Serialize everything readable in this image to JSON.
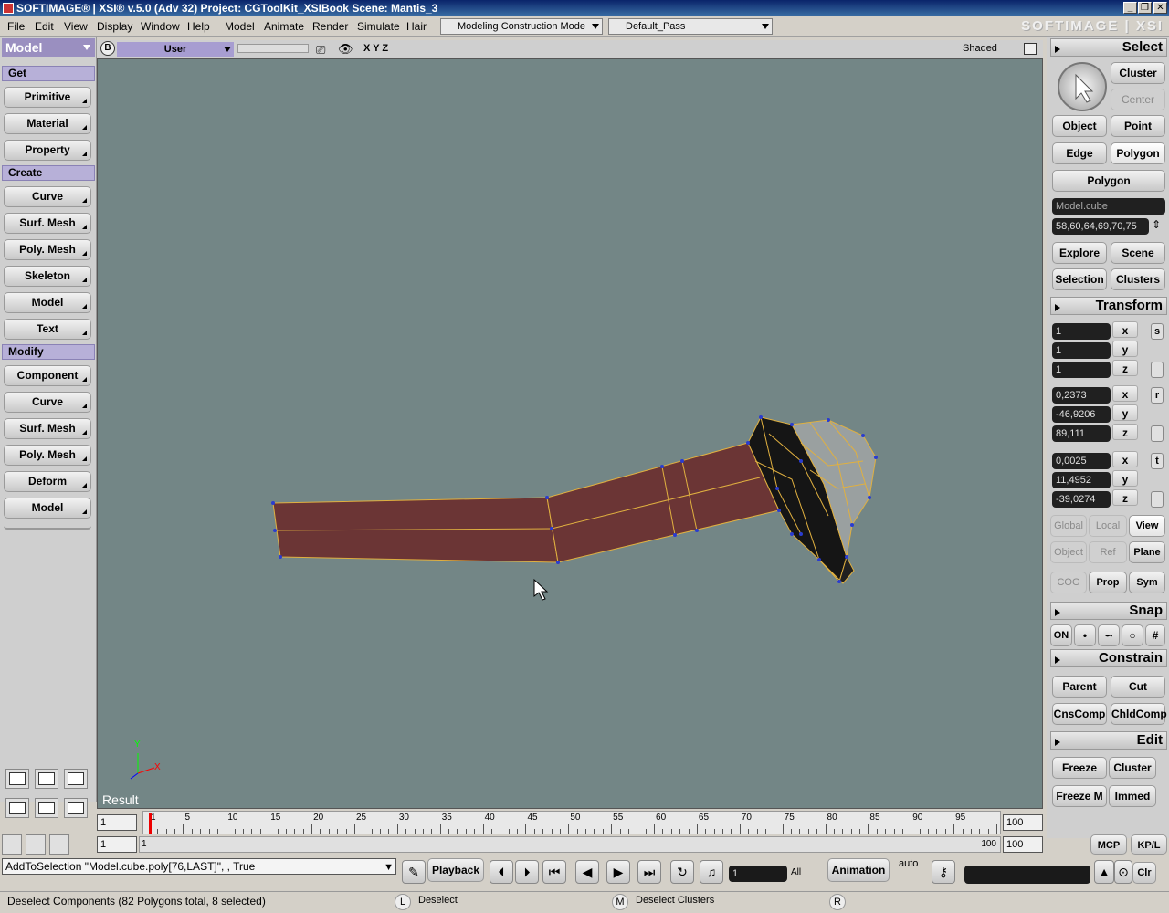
{
  "titlebar": {
    "title": "SOFTIMAGE® | XSI® v.5.0 (Adv 32) Project: CGToolKit_XSIBook     Scene: Mantis_3",
    "minimize": "_",
    "restore": "❐",
    "close": "✕"
  },
  "menubar": {
    "items": [
      "File",
      "Edit",
      "View",
      "Display",
      "Window",
      "Help",
      "Model",
      "Animate",
      "Render",
      "Simulate",
      "Hair"
    ],
    "mode": "Modeling Construction Mode",
    "pass": "Default_Pass",
    "logo": "SOFTIMAGE | XSI"
  },
  "left": {
    "module": "Model",
    "get": "Get",
    "get_items": [
      "Primitive",
      "Material",
      "Property"
    ],
    "create": "Create",
    "create_items": [
      "Curve",
      "Surf. Mesh",
      "Poly. Mesh",
      "Skeleton",
      "Model",
      "Text"
    ],
    "modify": "Modify",
    "modify_items": [
      "Component",
      "Curve",
      "Surf. Mesh",
      "Poly. Mesh",
      "Deform",
      "Model"
    ]
  },
  "viewport": {
    "b_button": "B",
    "camera": "User",
    "axes_label": "X Y Z",
    "shading": "Shaded",
    "result_label": "Result",
    "axis_y": "Y",
    "axis_x": "X"
  },
  "right": {
    "select_title": "Select",
    "cluster": "Cluster",
    "center": "Center",
    "object": "Object",
    "point": "Point",
    "edge": "Edge",
    "polygon": "Polygon",
    "polygon_menu": "Polygon",
    "selection_name": "Model.cube",
    "selection_ids": "58,60,64,69,70,75",
    "explore": "Explore",
    "scene": "Scene",
    "selection": "Selection",
    "clusters": "Clusters",
    "transform_title": "Transform",
    "scale": [
      "1",
      "1",
      "1"
    ],
    "rotate": [
      "0,2373",
      "-46,9206",
      "89,111"
    ],
    "translate": [
      "0,0025",
      "11,4952",
      "-39,0274"
    ],
    "axis_labels": [
      "x",
      "y",
      "z"
    ],
    "s_icon": "s",
    "r_icon": "r",
    "t_icon": "t",
    "global": "Global",
    "local": "Local",
    "view": "View",
    "obj": "Object",
    "ref": "Ref",
    "plane": "Plane",
    "cog": "COG",
    "prop": "Prop",
    "sym": "Sym",
    "snap_title": "Snap",
    "snap_on": "ON",
    "constrain_title": "Constrain",
    "parent": "Parent",
    "cut": "Cut",
    "cnscomp": "CnsComp",
    "chldcomp": "ChldComp",
    "edit_title": "Edit",
    "freeze": "Freeze",
    "edit_cluster": "Cluster",
    "freeze_m": "Freeze M",
    "immed": "Immed"
  },
  "timeline": {
    "start": "1",
    "end": "100",
    "start2": "1",
    "end2": "100",
    "current": "1",
    "ticks": [
      "1",
      "5",
      "10",
      "15",
      "20",
      "25",
      "30",
      "35",
      "40",
      "45",
      "50",
      "55",
      "60",
      "65",
      "70",
      "75",
      "80",
      "85",
      "90",
      "95"
    ],
    "range_end": "100",
    "range_start": "1",
    "mcp": "MCP",
    "kpl": "KP/L"
  },
  "command": {
    "text": "AddToSelection \"Model.cube.poly[76,LAST]\", , True",
    "playback": "Playback",
    "frame": "1",
    "all": "All",
    "animation": "Animation",
    "auto": "auto",
    "clr": "Clr"
  },
  "status": {
    "message": "Deselect Components (82 Polygons total, 8 selected)",
    "l_key": "L",
    "l_action": "Deselect",
    "m_key": "M",
    "m_action": "Deselect Clusters",
    "r_key": "R"
  }
}
